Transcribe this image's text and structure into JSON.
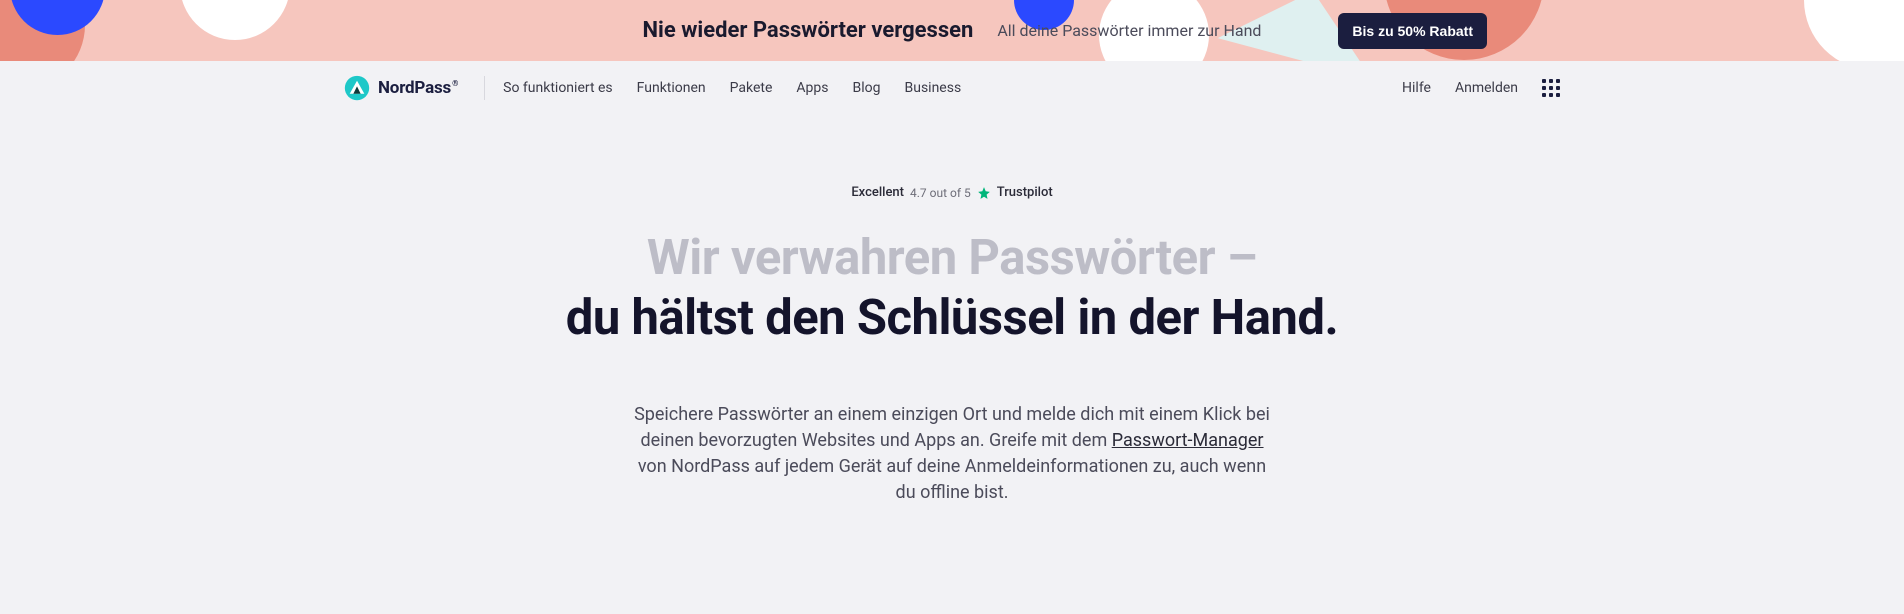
{
  "banner": {
    "title": "Nie wieder Passwörter vergessen",
    "subtitle": "All deine Passwörter immer zur Hand",
    "cta": "Bis zu 50% Rabatt"
  },
  "logo": {
    "name": "NordPass",
    "reg": "®"
  },
  "nav": {
    "items": [
      "So funktioniert es",
      "Funktionen",
      "Pakete",
      "Apps",
      "Blog",
      "Business"
    ],
    "right": {
      "help": "Hilfe",
      "login": "Anmelden"
    }
  },
  "trustpilot": {
    "label": "Excellent",
    "score": "4.7 out of 5",
    "brand": "Trustpilot"
  },
  "headline": {
    "line1": "Wir verwahren Passwörter –",
    "line2": "du hältst den Schlüssel in der Hand."
  },
  "sub": {
    "text_before": "Speichere Passwörter an einem einzigen Ort und melde dich mit einem Klick bei deinen bevorzugten Websites und Apps an. Greife mit dem ",
    "link": "Passwort-Manager",
    "text_after": " von NordPass auf jedem Gerät auf deine Anmeldeinformationen zu, auch wenn du offline bist."
  }
}
